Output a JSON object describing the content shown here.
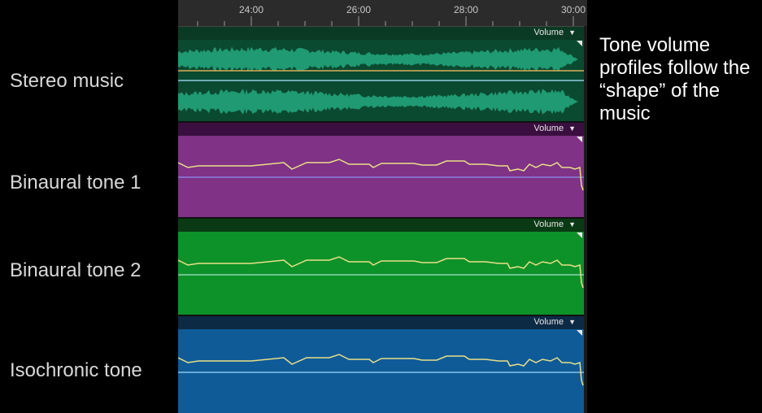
{
  "tracks": [
    {
      "label": "Stereo music",
      "dropdown": "Volume",
      "header_color": "#0b3a24",
      "body_color": "#0a4a30",
      "wave_color": "#1f9a72"
    },
    {
      "label": "Binaural tone 1",
      "dropdown": "Volume",
      "header_color": "#3a0f3f",
      "body_color": "#7f3286",
      "line_color": "#8a7fe0"
    },
    {
      "label": "Binaural tone 2",
      "dropdown": "Volume",
      "header_color": "#0a3a14",
      "body_color": "#0d9229",
      "line_color": "#8fd2b3"
    },
    {
      "label": "Isochronic tone",
      "dropdown": "Volume",
      "header_color": "#0d2a45",
      "body_color": "#0e5b98",
      "line_color": "#86c6e6"
    }
  ],
  "ruler": {
    "labels": [
      "24:00",
      "26:00",
      "28:00",
      "30:00"
    ]
  },
  "annotation": "Tone volume profiles follow the “shape” of the music",
  "icons": {
    "dropdown": "chevron-down-icon"
  },
  "envelope_color": "#e8e088"
}
